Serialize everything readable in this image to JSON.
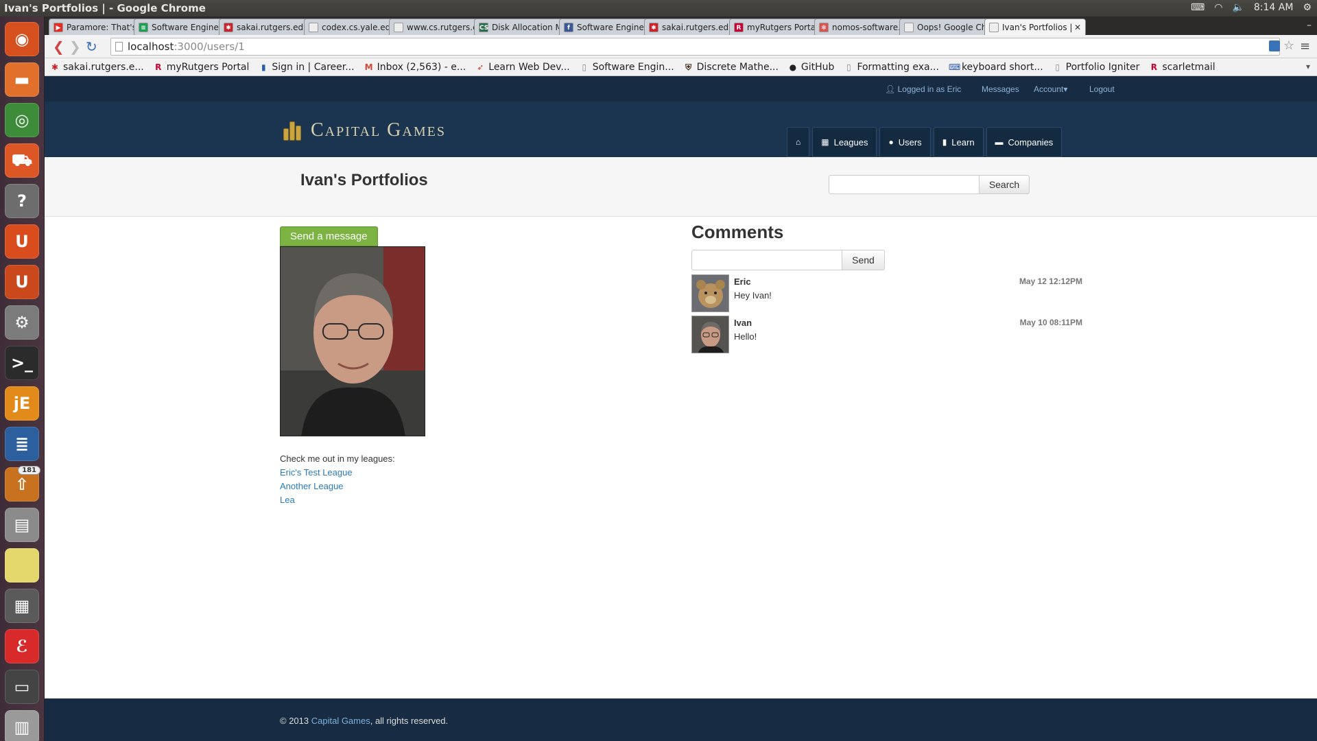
{
  "os": {
    "window_title": "Ivan's Portfolios | - Google Chrome",
    "clock": "8:14 AM",
    "tray_icons": [
      "keyboard-icon",
      "wifi-icon",
      "volume-icon",
      "gear-icon"
    ]
  },
  "launcher": {
    "items": [
      {
        "name": "ubuntu-dash-icon",
        "color": "#d64f1e",
        "glyph": "◉"
      },
      {
        "name": "files-icon",
        "color": "#e0702b",
        "glyph": "▬"
      },
      {
        "name": "chrome-icon",
        "color": "#3d8c3a",
        "glyph": "◎"
      },
      {
        "name": "software-center-icon",
        "color": "#dd5726",
        "glyph": "⛟"
      },
      {
        "name": "help-icon",
        "color": "#6d6d6d",
        "glyph": "?"
      },
      {
        "name": "ubuntu-one-icon",
        "color": "#d94c1d",
        "glyph": "U"
      },
      {
        "name": "ubuntu-one-music-icon",
        "color": "#c9481c",
        "glyph": "U"
      },
      {
        "name": "system-settings-icon",
        "color": "#7b7b7b",
        "glyph": "⚙"
      },
      {
        "name": "terminal-icon",
        "color": "#2b2b2b",
        "glyph": ">_"
      },
      {
        "name": "jedit-icon",
        "color": "#e28a1a",
        "glyph": "jE"
      },
      {
        "name": "writer-icon",
        "color": "#2c5f9e",
        "glyph": "≣"
      },
      {
        "name": "update-manager-icon",
        "color": "#c8711f",
        "glyph": "⇧",
        "badge": "181"
      },
      {
        "name": "scanner-icon",
        "color": "#8b8b8b",
        "glyph": "▤"
      },
      {
        "name": "notes-icon",
        "color": "#e4d76c",
        "glyph": ""
      },
      {
        "name": "calculator-icon",
        "color": "#5a5a5a",
        "glyph": "▦"
      },
      {
        "name": "pdf-reader-icon",
        "color": "#d82a2a",
        "glyph": "ℰ"
      },
      {
        "name": "workspace-switcher-icon",
        "color": "#444444",
        "glyph": "▭"
      },
      {
        "name": "trash-icon",
        "color": "#9a9a9a",
        "glyph": "▥"
      }
    ]
  },
  "tabs": [
    {
      "title": "Paramore: That's",
      "fav_color": "#e52d27",
      "fav_glyph": "▶"
    },
    {
      "title": "Software Enginee",
      "fav_color": "#1e9e55",
      "fav_glyph": "≡"
    },
    {
      "title": "sakai.rutgers.edu",
      "fav_color": "#cc2229",
      "fav_glyph": "✱"
    },
    {
      "title": "codex.cs.yale.edu",
      "fav_color": "#eeeeee",
      "fav_glyph": ""
    },
    {
      "title": "www.cs.rutgers.e",
      "fav_color": "#eeeeee",
      "fav_glyph": ""
    },
    {
      "title": "Disk Allocation M",
      "fav_color": "#2a6e4e",
      "fav_glyph": "CS"
    },
    {
      "title": "Software Enginee",
      "fav_color": "#3b5998",
      "fav_glyph": "f"
    },
    {
      "title": "sakai.rutgers.edu",
      "fav_color": "#cc2229",
      "fav_glyph": "✱"
    },
    {
      "title": "myRutgers Portal",
      "fav_color": "#cc0033",
      "fav_glyph": "R"
    },
    {
      "title": "nomos-software.c",
      "fav_color": "#d9534f",
      "fav_glyph": "✻"
    },
    {
      "title": "Oops! Google Chr",
      "fav_color": "#eeeeee",
      "fav_glyph": ""
    },
    {
      "title": "Ivan's Portfolios |",
      "fav_color": "#eeeeee",
      "fav_glyph": "",
      "active": true
    }
  ],
  "toolbar": {
    "url_host": "localhost",
    "url_path": ":3000/users/1"
  },
  "bookmarks": [
    {
      "label": "sakai.rutgers.e...",
      "color": "#cc2229",
      "glyph": "✱"
    },
    {
      "label": "myRutgers Portal",
      "color": "#cc0033",
      "glyph": "R"
    },
    {
      "label": "Sign in | Career...",
      "color": "#2d5aa6",
      "glyph": "▮"
    },
    {
      "label": "Inbox (2,563) - e...",
      "color": "#d14836",
      "glyph": "M"
    },
    {
      "label": "Learn Web Dev...",
      "color": "#c23b22",
      "glyph": "➶"
    },
    {
      "label": "Software Engin...",
      "color": "#888888",
      "glyph": "▯"
    },
    {
      "label": "Discrete Mathe...",
      "color": "#3c2a1a",
      "glyph": "⛨"
    },
    {
      "label": "GitHub",
      "color": "#222222",
      "glyph": "●"
    },
    {
      "label": "Formatting exa...",
      "color": "#888888",
      "glyph": "▯"
    },
    {
      "label": "keyboard short...",
      "color": "#2d5aa6",
      "glyph": "⌨"
    },
    {
      "label": "Portfolio Igniter",
      "color": "#888888",
      "glyph": "▯"
    },
    {
      "label": "scarletmail",
      "color": "#cc0033",
      "glyph": "R"
    }
  ],
  "site": {
    "userbar": {
      "logged_in": "Logged in as Eric",
      "messages": "Messages",
      "account": "Account",
      "logout": "Logout"
    },
    "logo_text": "Capital Games",
    "nav": {
      "leagues": "Leagues",
      "users": "Users",
      "learn": "Learn",
      "companies": "Companies"
    },
    "page_title": "Ivan's Portfolios",
    "search_button": "Search",
    "send_message": "Send a message",
    "leagues_intro": "Check me out in my leagues:",
    "leagues": [
      "Eric's Test League",
      "Another League",
      "Lea"
    ],
    "comments_title": "Comments",
    "comment_send": "Send",
    "comments": [
      {
        "author": "Eric",
        "text": "Hey Ivan!",
        "time": "May 12 12:12PM"
      },
      {
        "author": "Ivan",
        "text": "Hello!",
        "time": "May 10 08:11PM"
      }
    ],
    "footer": {
      "prefix": "© 2013 ",
      "link": "Capital Games",
      "suffix": ", all rights reserved."
    }
  }
}
